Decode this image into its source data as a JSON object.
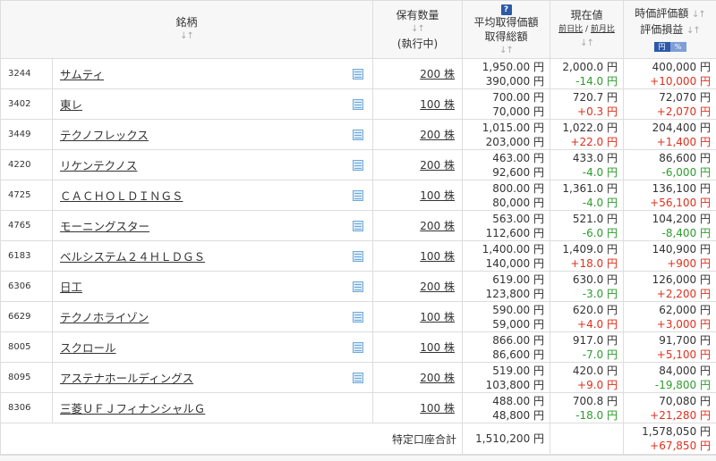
{
  "header": {
    "stock": "銘柄",
    "qty_line1": "保有数量",
    "qty_line2": "(執行中)",
    "avg_line1": "平均取得価額",
    "avg_line2": "取得総額",
    "help_icon": "?",
    "price_title": "現在値",
    "price_sub1": "前日比",
    "price_sep": " / ",
    "price_sub2": "前月比",
    "eval_line1": "時価評価額",
    "eval_line2": "評価損益",
    "toggle_yen": "円",
    "toggle_pct": "%",
    "sort_icon": "↓↑"
  },
  "rows": [
    {
      "code": "3244",
      "name": "サムティ",
      "qty": "200 株",
      "avg": "1,950.00 円",
      "total": "390,000 円",
      "price": "2,000.0 円",
      "change": "-14.0 円",
      "value": "400,000 円",
      "pl": "+10,000 円",
      "memo": true
    },
    {
      "code": "3402",
      "name": "東レ",
      "qty": "100 株",
      "avg": "700.00 円",
      "total": "70,000 円",
      "price": "720.7 円",
      "change": "+0.3 円",
      "value": "72,070 円",
      "pl": "+2,070 円",
      "memo": true
    },
    {
      "code": "3449",
      "name": "テクノフレックス",
      "qty": "200 株",
      "avg": "1,015.00 円",
      "total": "203,000 円",
      "price": "1,022.0 円",
      "change": "+22.0 円",
      "value": "204,400 円",
      "pl": "+1,400 円",
      "memo": true
    },
    {
      "code": "4220",
      "name": "リケンテクノス",
      "qty": "200 株",
      "avg": "463.00 円",
      "total": "92,600 円",
      "price": "433.0 円",
      "change": "-4.0 円",
      "value": "86,600 円",
      "pl": "-6,000 円",
      "memo": true
    },
    {
      "code": "4725",
      "name": "ＣＡＣＨＯＬＤＩＮＧＳ",
      "qty": "100 株",
      "avg": "800.00 円",
      "total": "80,000 円",
      "price": "1,361.0 円",
      "change": "-4.0 円",
      "value": "136,100 円",
      "pl": "+56,100 円",
      "memo": true
    },
    {
      "code": "4765",
      "name": "モーニングスター",
      "qty": "200 株",
      "avg": "563.00 円",
      "total": "112,600 円",
      "price": "521.0 円",
      "change": "-6.0 円",
      "value": "104,200 円",
      "pl": "-8,400 円",
      "memo": true
    },
    {
      "code": "6183",
      "name": "ベルシステム２４ＨＬＤＧＳ",
      "qty": "100 株",
      "avg": "1,400.00 円",
      "total": "140,000 円",
      "price": "1,409.0 円",
      "change": "+18.0 円",
      "value": "140,900 円",
      "pl": "+900 円",
      "memo": true
    },
    {
      "code": "6306",
      "name": "日工",
      "qty": "200 株",
      "avg": "619.00 円",
      "total": "123,800 円",
      "price": "630.0 円",
      "change": "-3.0 円",
      "value": "126,000 円",
      "pl": "+2,200 円",
      "memo": true
    },
    {
      "code": "6629",
      "name": "テクノホライゾン",
      "qty": "100 株",
      "avg": "590.00 円",
      "total": "59,000 円",
      "price": "620.0 円",
      "change": "+4.0 円",
      "value": "62,000 円",
      "pl": "+3,000 円",
      "memo": true
    },
    {
      "code": "8005",
      "name": "スクロール",
      "qty": "100 株",
      "avg": "866.00 円",
      "total": "86,600 円",
      "price": "917.0 円",
      "change": "-7.0 円",
      "value": "91,700 円",
      "pl": "+5,100 円",
      "memo": true
    },
    {
      "code": "8095",
      "name": "アステナホールディングス",
      "qty": "200 株",
      "avg": "519.00 円",
      "total": "103,800 円",
      "price": "420.0 円",
      "change": "+9.0 円",
      "value": "84,000 円",
      "pl": "-19,800 円",
      "memo": true
    },
    {
      "code": "8306",
      "name": "三菱ＵＦＪフィナンシャルＧ",
      "qty": "100 株",
      "avg": "488.00 円",
      "total": "48,800 円",
      "price": "700.8 円",
      "change": "-18.0 円",
      "value": "70,080 円",
      "pl": "+21,280 円",
      "memo": false
    }
  ],
  "summary": {
    "label": "特定口座合計",
    "total_cost": "1,510,200 円",
    "total_value": "1,578,050 円",
    "total_pl": "+67,850 円"
  },
  "colors": {
    "positive": "#e0301e",
    "negative": "#2e9c2e",
    "accent": "#2d5aa8"
  }
}
